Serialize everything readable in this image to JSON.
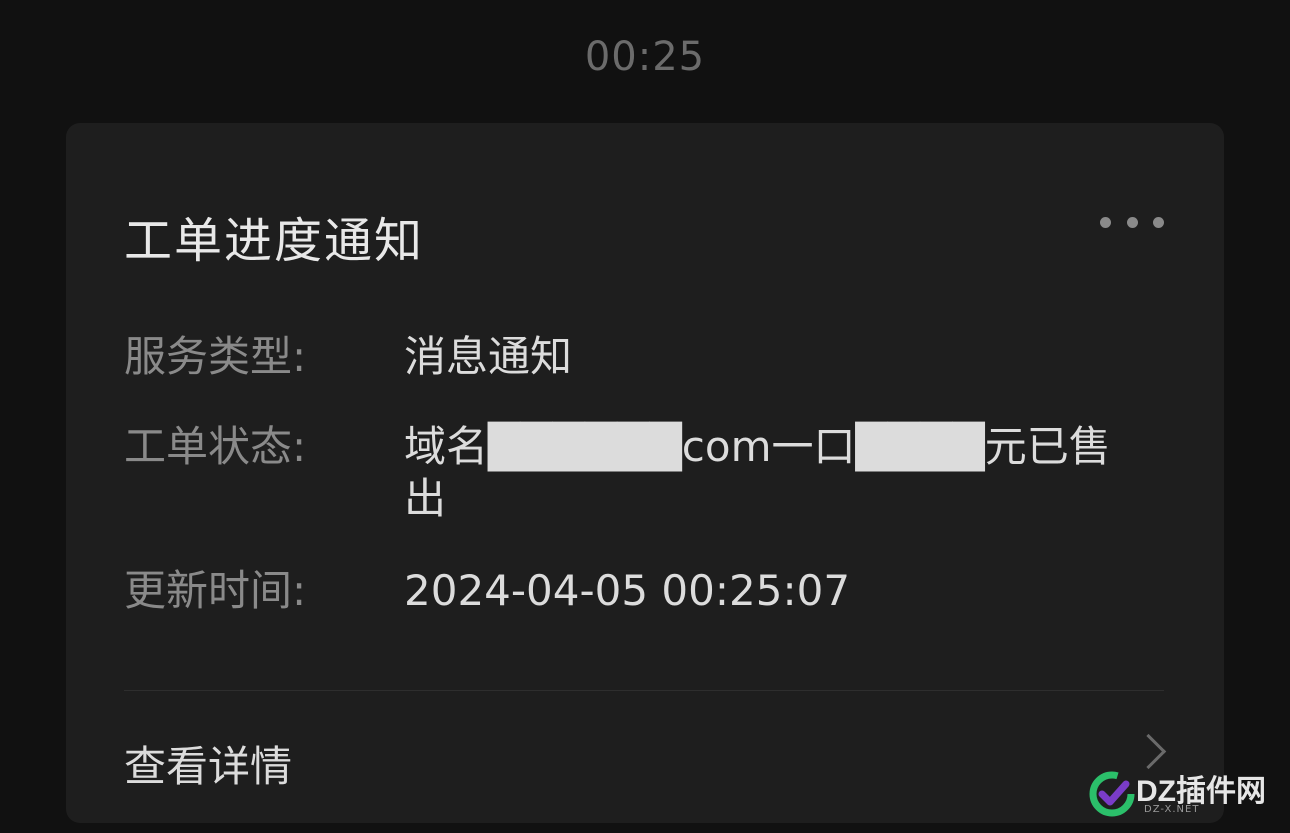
{
  "chat": {
    "timestamp": "00:25"
  },
  "card": {
    "title": "工单进度通知",
    "more_icon": "more-dots-icon",
    "fields": [
      {
        "label": "服务类型:",
        "value": "消息通知"
      },
      {
        "label": "工单状态:",
        "value": "域名██████com一口████元已售出"
      },
      {
        "label": "更新时间:",
        "value": "2024-04-05 00:25:07"
      }
    ],
    "detail_link": {
      "label": "查看详情",
      "icon": "chevron-right-icon"
    }
  },
  "watermark": {
    "brand": "DZ插件网",
    "domain": "DZ-X.NET",
    "logo_icon": "dz-logo-icon",
    "colors": {
      "logo_green": "#2bbf6a",
      "logo_purple": "#7a3cc8"
    }
  }
}
